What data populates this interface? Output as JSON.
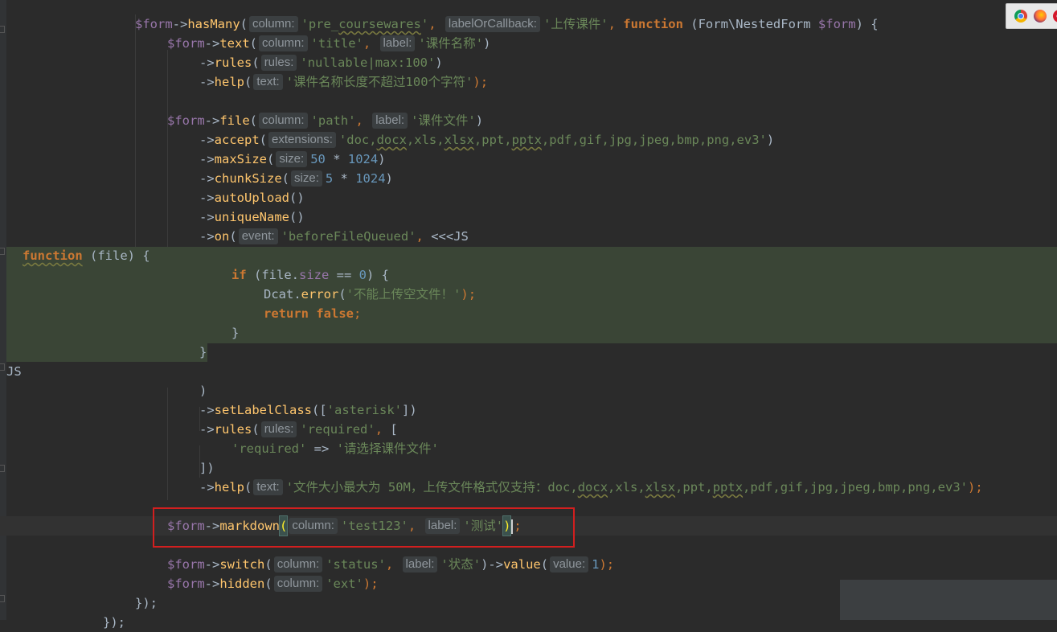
{
  "editor": {
    "language": "PHP",
    "colors": {
      "background": "#2b2b2b",
      "variable": "#9876aa",
      "method": "#ffc66d",
      "string": "#6a8759",
      "keyword": "#cc7832",
      "number": "#6897bb",
      "injected_language_band": "#3a4536",
      "highlight_box": "#d21f1f"
    },
    "lines": [
      {
        "segs": [
          {
            "t": "$form",
            "c": "var"
          },
          {
            "t": "->"
          },
          {
            "t": "hasMany",
            "c": "fn"
          },
          {
            "t": "("
          },
          {
            "h": "column:"
          },
          {
            "t": "'pre_",
            "c": "str"
          },
          {
            "t": "coursewares",
            "c": "str uline"
          },
          {
            "t": "'",
            "c": "str"
          },
          {
            "t": ", ",
            "c": "kwn"
          },
          {
            "h": "labelOrCallback:"
          },
          {
            "t": "'上传课件'",
            "c": "str"
          },
          {
            "t": ", ",
            "c": "kwn"
          },
          {
            "t": "function",
            "c": "kw"
          },
          {
            "t": " (Form\\NestedForm "
          },
          {
            "t": "$form",
            "c": "var"
          },
          {
            "t": ") {"
          }
        ]
      },
      {
        "segs": [
          {
            "t": "$form",
            "c": "var"
          },
          {
            "t": "->"
          },
          {
            "t": "text",
            "c": "fn"
          },
          {
            "t": "("
          },
          {
            "h": "column:"
          },
          {
            "t": "'title'",
            "c": "str"
          },
          {
            "t": ", ",
            "c": "kwn"
          },
          {
            "h": "label:"
          },
          {
            "t": "'课件名称'",
            "c": "str"
          },
          {
            "t": ")"
          }
        ]
      },
      {
        "segs": [
          {
            "t": "->"
          },
          {
            "t": "rules",
            "c": "fn"
          },
          {
            "t": "("
          },
          {
            "h": "rules:"
          },
          {
            "t": "'nullable|max:100'",
            "c": "str"
          },
          {
            "t": ")"
          }
        ]
      },
      {
        "segs": [
          {
            "t": "->"
          },
          {
            "t": "help",
            "c": "fn"
          },
          {
            "t": "("
          },
          {
            "h": "text:"
          },
          {
            "t": "'课件名称长度不超过100个字符'",
            "c": "str"
          },
          {
            "t": ");",
            "c": "kwn"
          }
        ]
      },
      {
        "segs": []
      },
      {
        "segs": [
          {
            "t": "$form",
            "c": "var"
          },
          {
            "t": "->"
          },
          {
            "t": "file",
            "c": "fn"
          },
          {
            "t": "("
          },
          {
            "h": "column:"
          },
          {
            "t": "'path'",
            "c": "str"
          },
          {
            "t": ", ",
            "c": "kwn"
          },
          {
            "h": "label:"
          },
          {
            "t": "'课件文件'",
            "c": "str"
          },
          {
            "t": ")"
          }
        ]
      },
      {
        "segs": [
          {
            "t": "->"
          },
          {
            "t": "accept",
            "c": "fn"
          },
          {
            "t": "("
          },
          {
            "h": "extensions:"
          },
          {
            "t": "'doc,",
            "c": "str"
          },
          {
            "t": "docx",
            "c": "str uline"
          },
          {
            "t": ",xls,",
            "c": "str"
          },
          {
            "t": "xlsx",
            "c": "str uline"
          },
          {
            "t": ",ppt,",
            "c": "str"
          },
          {
            "t": "pptx",
            "c": "str uline"
          },
          {
            "t": ",pdf,gif,jpg,jpeg,bmp,png,ev3'",
            "c": "str"
          },
          {
            "t": ")"
          }
        ]
      },
      {
        "segs": [
          {
            "t": "->"
          },
          {
            "t": "maxSize",
            "c": "fn"
          },
          {
            "t": "("
          },
          {
            "h": "size:"
          },
          {
            "t": "50",
            "c": "num"
          },
          {
            "t": " * "
          },
          {
            "t": "1024",
            "c": "num"
          },
          {
            "t": ")"
          }
        ]
      },
      {
        "segs": [
          {
            "t": "->"
          },
          {
            "t": "chunkSize",
            "c": "fn"
          },
          {
            "t": "("
          },
          {
            "h": "size:"
          },
          {
            "t": "5",
            "c": "num"
          },
          {
            "t": " * "
          },
          {
            "t": "1024",
            "c": "num"
          },
          {
            "t": ")"
          }
        ]
      },
      {
        "segs": [
          {
            "t": "->"
          },
          {
            "t": "autoUpload",
            "c": "fn"
          },
          {
            "t": "()"
          }
        ]
      },
      {
        "segs": [
          {
            "t": "->"
          },
          {
            "t": "uniqueName",
            "c": "fn"
          },
          {
            "t": "()"
          }
        ]
      },
      {
        "segs": [
          {
            "t": "->"
          },
          {
            "t": "on",
            "c": "fn"
          },
          {
            "t": "("
          },
          {
            "h": "event:"
          },
          {
            "t": "'beforeFileQueued'",
            "c": "str"
          },
          {
            "t": ", ",
            "c": "kwn"
          },
          {
            "t": "<<<JS"
          }
        ]
      },
      {
        "segs": [
          {
            "t": "function",
            "c": "kw uline"
          },
          {
            "t": " (file) {"
          }
        ]
      },
      {
        "segs": [
          {
            "t": "if",
            "c": "kw"
          },
          {
            "t": " ("
          },
          {
            "t": "file.",
            "c": "ident"
          },
          {
            "t": "size",
            "c": "field"
          },
          {
            "t": " == "
          },
          {
            "t": "0",
            "c": "num"
          },
          {
            "t": ") {"
          }
        ]
      },
      {
        "segs": [
          {
            "t": "Dcat.",
            "c": "ident"
          },
          {
            "t": "error",
            "c": "fn"
          },
          {
            "t": "("
          },
          {
            "t": "'不能上传空文件！'",
            "c": "str"
          },
          {
            "t": ");",
            "c": "kwn"
          }
        ]
      },
      {
        "segs": [
          {
            "t": "return",
            "c": "kw"
          },
          {
            "t": " "
          },
          {
            "t": "false",
            "c": "kw"
          },
          {
            "t": ";",
            "c": "kwn"
          }
        ]
      },
      {
        "segs": [
          {
            "t": "}"
          }
        ]
      },
      {
        "segs": [
          {
            "t": "}"
          }
        ]
      },
      {
        "segs": [
          {
            "t": "JS"
          }
        ]
      },
      {
        "segs": [
          {
            "t": ")"
          }
        ]
      },
      {
        "segs": [
          {
            "t": "->"
          },
          {
            "t": "setLabelClass",
            "c": "fn"
          },
          {
            "t": "(["
          },
          {
            "t": "'asterisk'",
            "c": "str"
          },
          {
            "t": "])"
          }
        ]
      },
      {
        "segs": [
          {
            "t": "->"
          },
          {
            "t": "rules",
            "c": "fn"
          },
          {
            "t": "("
          },
          {
            "h": "rules:"
          },
          {
            "t": "'required'",
            "c": "str"
          },
          {
            "t": ", ",
            "c": "kwn"
          },
          {
            "t": "["
          }
        ]
      },
      {
        "segs": [
          {
            "t": "'required'",
            "c": "str"
          },
          {
            "t": " => "
          },
          {
            "t": "'请选择课件文件'",
            "c": "str"
          }
        ]
      },
      {
        "segs": [
          {
            "t": "])"
          }
        ]
      },
      {
        "segs": [
          {
            "t": "->"
          },
          {
            "t": "help",
            "c": "fn"
          },
          {
            "t": "("
          },
          {
            "h": "text:"
          },
          {
            "t": "'文件大小最大为 50M，上传文件格式仅支持：doc,",
            "c": "str"
          },
          {
            "t": "docx",
            "c": "str uline"
          },
          {
            "t": ",xls,",
            "c": "str"
          },
          {
            "t": "xlsx",
            "c": "str uline"
          },
          {
            "t": ",ppt,",
            "c": "str"
          },
          {
            "t": "pptx",
            "c": "str uline"
          },
          {
            "t": ",pdf,gif,jpg,jpeg,bmp,png,ev3'",
            "c": "str"
          },
          {
            "t": ");",
            "c": "kwn"
          }
        ]
      },
      {
        "segs": []
      },
      {
        "segs": [
          {
            "t": "$form",
            "c": "var"
          },
          {
            "t": "->"
          },
          {
            "t": "markdown",
            "c": "fn"
          },
          {
            "t": "(",
            "c": "bracematch"
          },
          {
            "h": "column:"
          },
          {
            "t": "'test123'",
            "c": "str"
          },
          {
            "t": ", ",
            "c": "kwn"
          },
          {
            "h": "label:"
          },
          {
            "t": "'测试'",
            "c": "str"
          },
          {
            "t": ")",
            "c": "bracematch"
          },
          {
            "caret": true
          },
          {
            "t": ";",
            "c": "kwn"
          }
        ]
      },
      {
        "segs": []
      },
      {
        "segs": [
          {
            "t": "$form",
            "c": "var"
          },
          {
            "t": "->"
          },
          {
            "t": "switch",
            "c": "fn"
          },
          {
            "t": "("
          },
          {
            "h": "column:"
          },
          {
            "t": "'status'",
            "c": "str"
          },
          {
            "t": ", ",
            "c": "kwn"
          },
          {
            "h": "label:"
          },
          {
            "t": "'状态'",
            "c": "str"
          },
          {
            "t": ")->"
          },
          {
            "t": "value",
            "c": "fn"
          },
          {
            "t": "("
          },
          {
            "h": "value:"
          },
          {
            "t": "1",
            "c": "num"
          },
          {
            "t": ");",
            "c": "kwn"
          }
        ]
      },
      {
        "segs": [
          {
            "t": "$form",
            "c": "var"
          },
          {
            "t": "->"
          },
          {
            "t": "hidden",
            "c": "fn"
          },
          {
            "t": "("
          },
          {
            "h": "column:"
          },
          {
            "t": "'ext'",
            "c": "str"
          },
          {
            "t": ");",
            "c": "kwn"
          }
        ]
      },
      {
        "segs": [
          {
            "t": "});"
          }
        ]
      },
      {
        "segs": [
          {
            "t": "});"
          }
        ]
      }
    ]
  },
  "browser_icons": [
    "chrome-icon",
    "firefox-icon",
    "opera-icon"
  ]
}
